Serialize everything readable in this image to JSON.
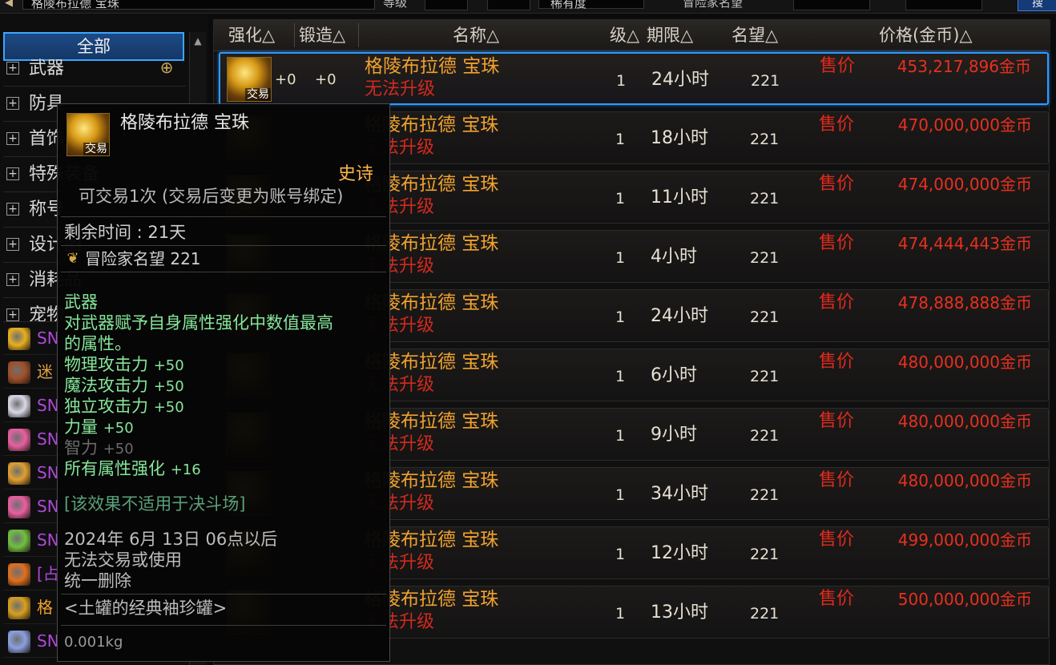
{
  "top": {
    "search_value": "格陵布拉德 宝珠",
    "level_label": "等级",
    "rarity_value": "稀有度",
    "fame_label": "冒险家名望",
    "search_button": "搜"
  },
  "categories": {
    "all_label": "全部",
    "items": [
      {
        "label": "武器"
      },
      {
        "label": "防具"
      },
      {
        "label": "首饰"
      },
      {
        "label": "特殊装备"
      },
      {
        "label": "称号"
      },
      {
        "label": "设计图"
      },
      {
        "label": "消耗品"
      },
      {
        "label": "宠物"
      }
    ]
  },
  "favorites": [
    {
      "text": "SN",
      "color": "#b048d8",
      "icon_color": "#e8b020"
    },
    {
      "text": "迷",
      "color": "#e0a040",
      "icon_color": "#a0502a"
    },
    {
      "text": "SN",
      "color": "#b048d8",
      "icon_color": "#d8d8e8"
    },
    {
      "text": "SN",
      "color": "#b048d8",
      "icon_color": "#e860a0"
    },
    {
      "text": "SN",
      "color": "#b048d8",
      "icon_color": "#e0a030"
    },
    {
      "text": "SN",
      "color": "#b048d8",
      "icon_color": "#e860a0"
    },
    {
      "text": "SN",
      "color": "#b048d8",
      "icon_color": "#70c040"
    },
    {
      "text": "[占",
      "color": "#b048d8",
      "icon_color": "#e07020"
    },
    {
      "text": "格",
      "color": "#f0a22e",
      "icon_color": "#d8a020"
    },
    {
      "text": "SN",
      "color": "#b048d8",
      "icon_color": "#8aa0e0"
    }
  ],
  "list": {
    "headers": {
      "reinforce": "强化△",
      "forge": "锻造△",
      "name": "名称△",
      "level": "级△",
      "duration": "期限△",
      "fame": "名望△",
      "price": "价格(金币)△"
    },
    "rows": [
      {
        "reinforce": "+0",
        "forge": "+0",
        "name": "格陵布拉德 宝珠",
        "status": "无法升级",
        "level": "1",
        "duration": "24小时",
        "fame": "221",
        "sell": "售价",
        "price": "453,217,896金币",
        "tag": "交易"
      },
      {
        "reinforce": "",
        "forge": "",
        "name": "格陵布拉德 宝珠",
        "status": "无法升级",
        "level": "1",
        "duration": "18小时",
        "fame": "221",
        "sell": "售价",
        "price": "470,000,000金币",
        "tag": ""
      },
      {
        "reinforce": "",
        "forge": "",
        "name": "格陵布拉德 宝珠",
        "status": "无法升级",
        "level": "1",
        "duration": "11小时",
        "fame": "221",
        "sell": "售价",
        "price": "474,000,000金币",
        "tag": ""
      },
      {
        "reinforce": "",
        "forge": "",
        "name": "格陵布拉德 宝珠",
        "status": "无法升级",
        "level": "1",
        "duration": "4小时",
        "fame": "221",
        "sell": "售价",
        "price": "474,444,443金币",
        "tag": ""
      },
      {
        "reinforce": "",
        "forge": "",
        "name": "格陵布拉德 宝珠",
        "status": "无法升级",
        "level": "1",
        "duration": "24小时",
        "fame": "221",
        "sell": "售价",
        "price": "478,888,888金币",
        "tag": ""
      },
      {
        "reinforce": "",
        "forge": "",
        "name": "格陵布拉德 宝珠",
        "status": "无法升级",
        "level": "1",
        "duration": "6小时",
        "fame": "221",
        "sell": "售价",
        "price": "480,000,000金币",
        "tag": ""
      },
      {
        "reinforce": "",
        "forge": "",
        "name": "格陵布拉德 宝珠",
        "status": "无法升级",
        "level": "1",
        "duration": "9小时",
        "fame": "221",
        "sell": "售价",
        "price": "480,000,000金币",
        "tag": ""
      },
      {
        "reinforce": "",
        "forge": "",
        "name": "格陵布拉德 宝珠",
        "status": "无法升级",
        "level": "1",
        "duration": "34小时",
        "fame": "221",
        "sell": "售价",
        "price": "480,000,000金币",
        "tag": ""
      },
      {
        "reinforce": "",
        "forge": "",
        "name": "格陵布拉德 宝珠",
        "status": "无法升级",
        "level": "1",
        "duration": "12小时",
        "fame": "221",
        "sell": "售价",
        "price": "499,000,000金币",
        "tag": ""
      },
      {
        "reinforce": "",
        "forge": "",
        "name": "格陵布拉德 宝珠",
        "status": "无法升级",
        "level": "1",
        "duration": "13小时",
        "fame": "221",
        "sell": "售价",
        "price": "500,000,000金币",
        "tag": ""
      }
    ]
  },
  "tooltip": {
    "icon_tag": "交易",
    "name": "格陵布拉德 宝珠",
    "rarity": "史诗",
    "trade": "可交易1次 (交易后变更为账号绑定)",
    "remaining": "剩余时间 : 21天",
    "fame": "冒险家名望 221",
    "slot": "武器",
    "desc1": "对武器赋予自身属性强化中数值最高",
    "desc2": "的属性。",
    "stats": [
      {
        "label": "物理攻击力",
        "value": "+50"
      },
      {
        "label": "魔法攻击力",
        "value": "+50"
      },
      {
        "label": "独立攻击力",
        "value": "+50"
      },
      {
        "label": "力量",
        "value": "+50"
      }
    ],
    "inactive_stat": {
      "label": "智力",
      "value": "+50"
    },
    "element": {
      "label": "所有属性强化",
      "value": "+16"
    },
    "note": "[该效果不适用于决斗场]",
    "expiry1": "2024年 6月 13日 06点以后",
    "expiry2": "无法交易或使用",
    "expiry3": "统一删除",
    "set_name": "<土罐的经典袖珍罐>",
    "weight": "0.001kg"
  },
  "colors": {
    "accent_blue": "#2f9cff",
    "item_orange": "#f0a22e",
    "price_red": "#e8301e",
    "stat_green": "#86e69a",
    "rarity_epic": "#ffb64a"
  }
}
